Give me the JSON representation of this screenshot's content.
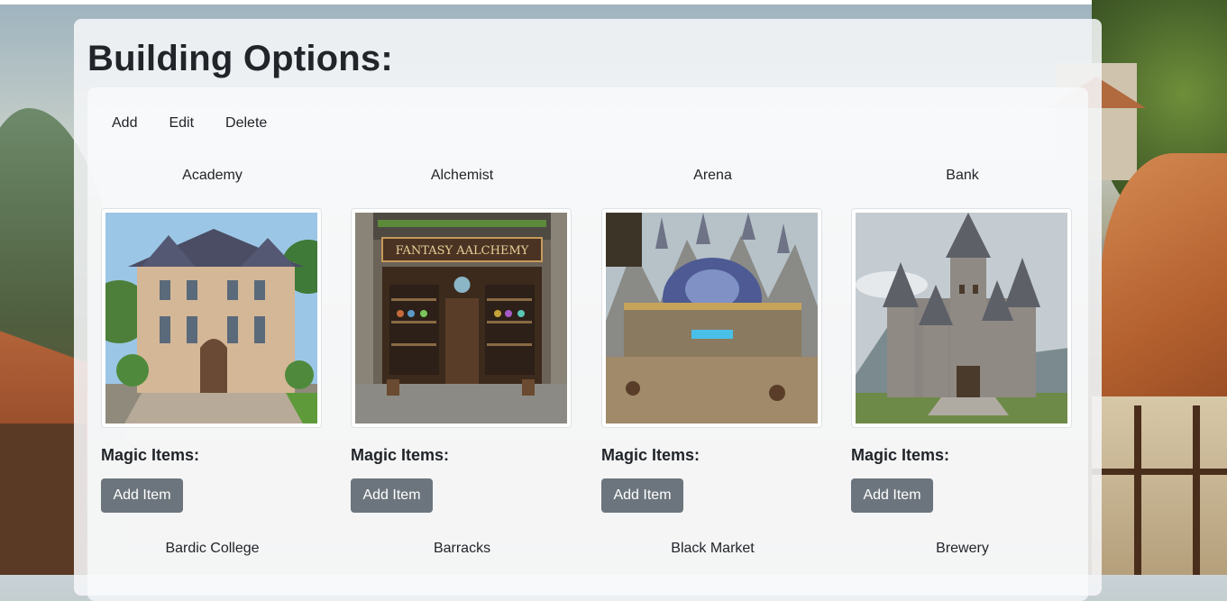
{
  "page": {
    "title": "Building Options:"
  },
  "toolbar": {
    "add_label": "Add",
    "edit_label": "Edit",
    "delete_label": "Delete"
  },
  "buildings": [
    {
      "name": "Academy",
      "magic_label": "Magic Items:",
      "button_label": "Add Item",
      "image": "academy-mansion-illustration"
    },
    {
      "name": "Alchemist",
      "magic_label": "Magic Items:",
      "button_label": "Add Item",
      "image": "alchemy-shop-illustration",
      "sign_text": "FANTASY AALCHEMY"
    },
    {
      "name": "Arena",
      "magic_label": "Magic Items:",
      "button_label": "Add Item",
      "image": "domed-arena-illustration"
    },
    {
      "name": "Bank",
      "magic_label": "Magic Items:",
      "button_label": "Add Item",
      "image": "stone-castle-illustration"
    }
  ],
  "buildings_row2": [
    {
      "name": "Bardic College"
    },
    {
      "name": "Barracks"
    },
    {
      "name": "Black Market"
    },
    {
      "name": "Brewery"
    }
  ],
  "colors": {
    "button_bg": "#6c757d",
    "button_text": "#ffffff",
    "heading_text": "#212529"
  }
}
